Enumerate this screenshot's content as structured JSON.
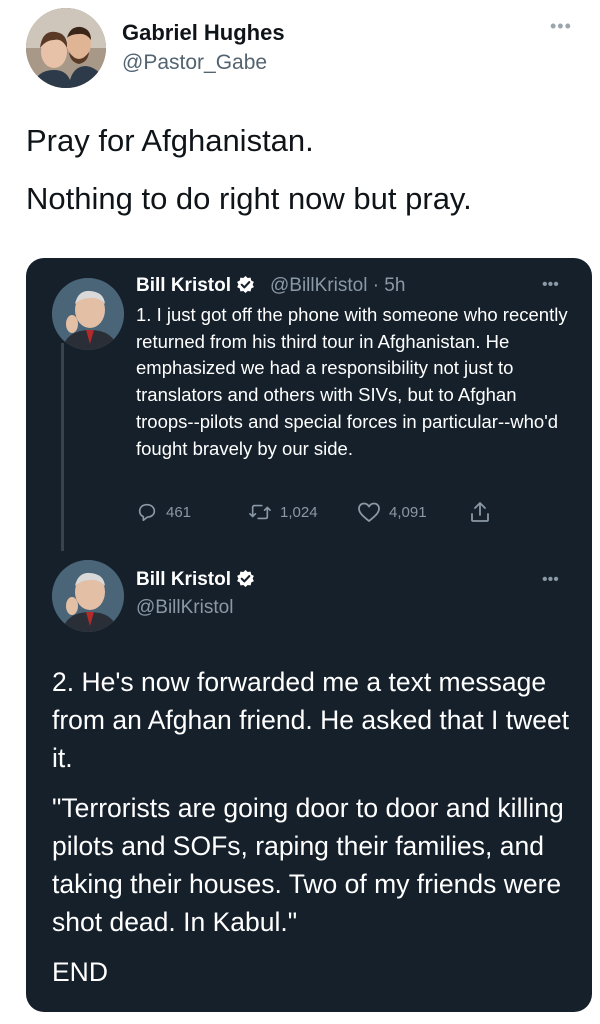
{
  "outer_tweet": {
    "name": "Gabriel Hughes",
    "handle": "@Pastor_Gabe",
    "more": "•••",
    "paragraphs": [
      "Pray for Afghanistan.",
      "Nothing to do right now but pray."
    ]
  },
  "quoted_thread": {
    "tweet1": {
      "name": "Bill Kristol",
      "handle_time": "@BillKristol · 5h",
      "more": "•••",
      "text": "1. I just got off the phone with someone who recently returned from his third tour in Afghanistan. He emphasized we had a responsibility not just to translators and others with SIVs, but to Afghan troops--pilots and special forces in particular--who'd fought bravely by our side.",
      "replies": "461",
      "retweets": "1,024",
      "likes": "4,091"
    },
    "tweet2": {
      "name": "Bill Kristol",
      "handle": "@BillKristol",
      "more": "•••",
      "p1": "2. He's now forwarded me a text message from an Afghan friend. He asked that I tweet it.",
      "p2": "\"Terrorists are going door to door and killing pilots and SOFs, raping their families, and taking their houses. Two of my friends were shot dead. In Kabul.\"",
      "p3": "END"
    }
  },
  "colors": {
    "card_bg": "#15202b",
    "verified": "#1d9bf0",
    "muted": "#8b98a5"
  }
}
